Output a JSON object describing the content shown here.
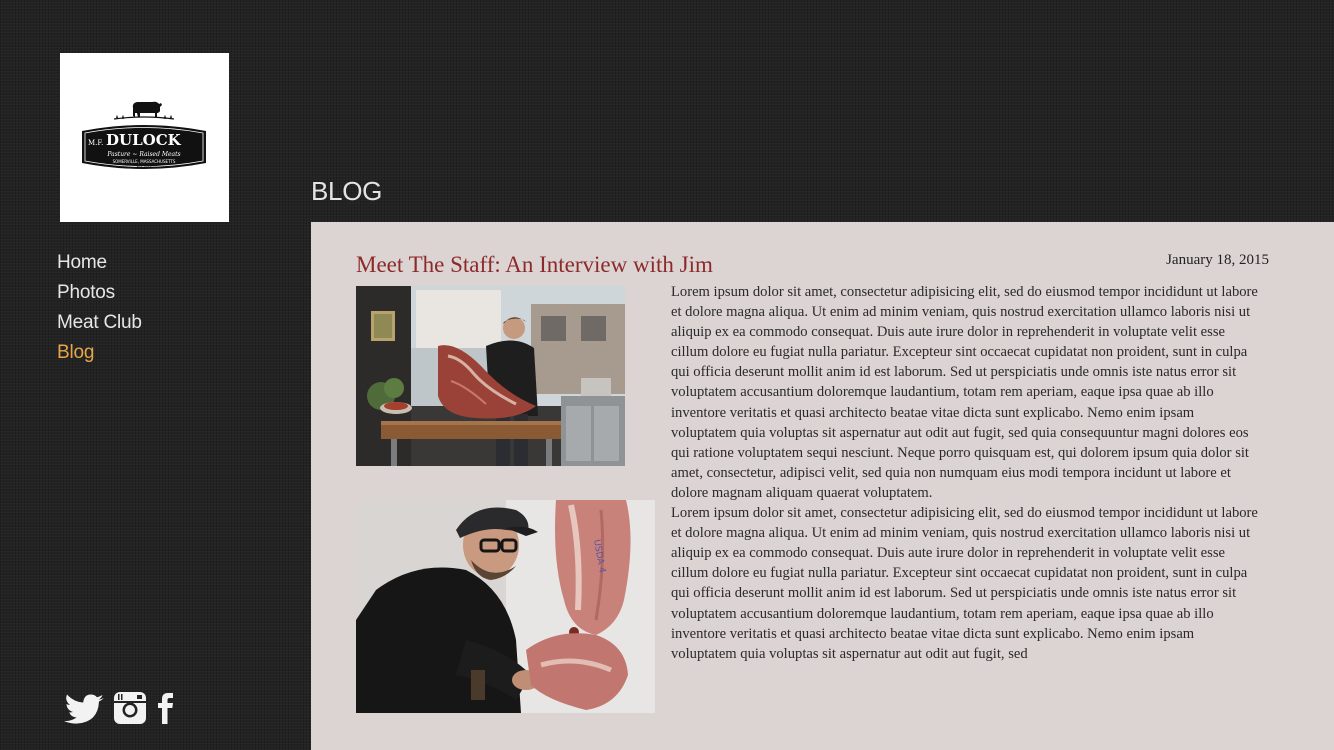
{
  "brand": {
    "logo_alt": "M.F. DULOCK Pasture-Raised Meats, Somerville, Massachusetts"
  },
  "nav": {
    "items": [
      {
        "label": "Home",
        "active": false
      },
      {
        "label": "Photos",
        "active": false
      },
      {
        "label": "Meat Club",
        "active": false
      },
      {
        "label": "Blog",
        "active": true
      }
    ],
    "active_color": "#e7a64a"
  },
  "social": {
    "icons": [
      "twitter-icon",
      "instagram-icon",
      "facebook-icon"
    ]
  },
  "page": {
    "title": "BLOG"
  },
  "post": {
    "title": "Meet The Staff: An Interview with Jim",
    "date": "January 18, 2015",
    "title_color": "#8c2a2a",
    "images": [
      {
        "alt": "Butcher carving a large cut of meat at a wooden table"
      },
      {
        "alt": "Butcher in cap and glasses handling a hanging side of meat"
      }
    ],
    "paragraphs": [
      "Lorem ipsum dolor sit amet, consectetur adipisicing elit, sed do eiusmod tempor incididunt ut labore et dolore magna aliqua. Ut enim ad minim veniam, quis nostrud exercitation ullamco laboris nisi ut aliquip ex ea commodo consequat. Duis aute irure dolor in reprehenderit in voluptate velit esse cillum dolore eu fugiat nulla pariatur. Excepteur sint occaecat cupidatat non proident, sunt in culpa qui officia deserunt mollit anim id est laborum. Sed ut perspiciatis unde omnis iste natus error sit voluptatem accusantium doloremque laudantium, totam rem aperiam, eaque ipsa quae ab illo inventore veritatis et quasi architecto beatae vitae dicta sunt explicabo. Nemo enim ipsam voluptatem quia voluptas sit aspernatur aut odit aut fugit, sed quia consequuntur magni dolores eos qui ratione voluptatem sequi nesciunt. Neque porro quisquam est, qui dolorem ipsum quia dolor sit amet, consectetur, adipisci velit, sed quia non numquam eius modi tempora incidunt ut labore et dolore magnam aliquam quaerat voluptatem.",
      "Lorem ipsum dolor sit amet, consectetur adipisicing elit, sed do eiusmod tempor incididunt ut labore et dolore magna aliqua. Ut enim ad minim veniam, quis nostrud exercitation ullamco laboris nisi ut aliquip ex ea commodo consequat. Duis aute irure dolor in reprehenderit in voluptate velit esse cillum dolore eu fugiat nulla pariatur. Excepteur sint occaecat cupidatat non proident, sunt in culpa qui officia deserunt mollit anim id est laborum. Sed ut perspiciatis unde omnis iste natus error sit voluptatem accusantium doloremque laudantium, totam rem aperiam, eaque ipsa quae ab illo inventore veritatis et quasi architecto beatae vitae dicta sunt explicabo. Nemo enim ipsam voluptatem quia voluptas sit aspernatur aut odit aut fugit, sed"
    ]
  }
}
